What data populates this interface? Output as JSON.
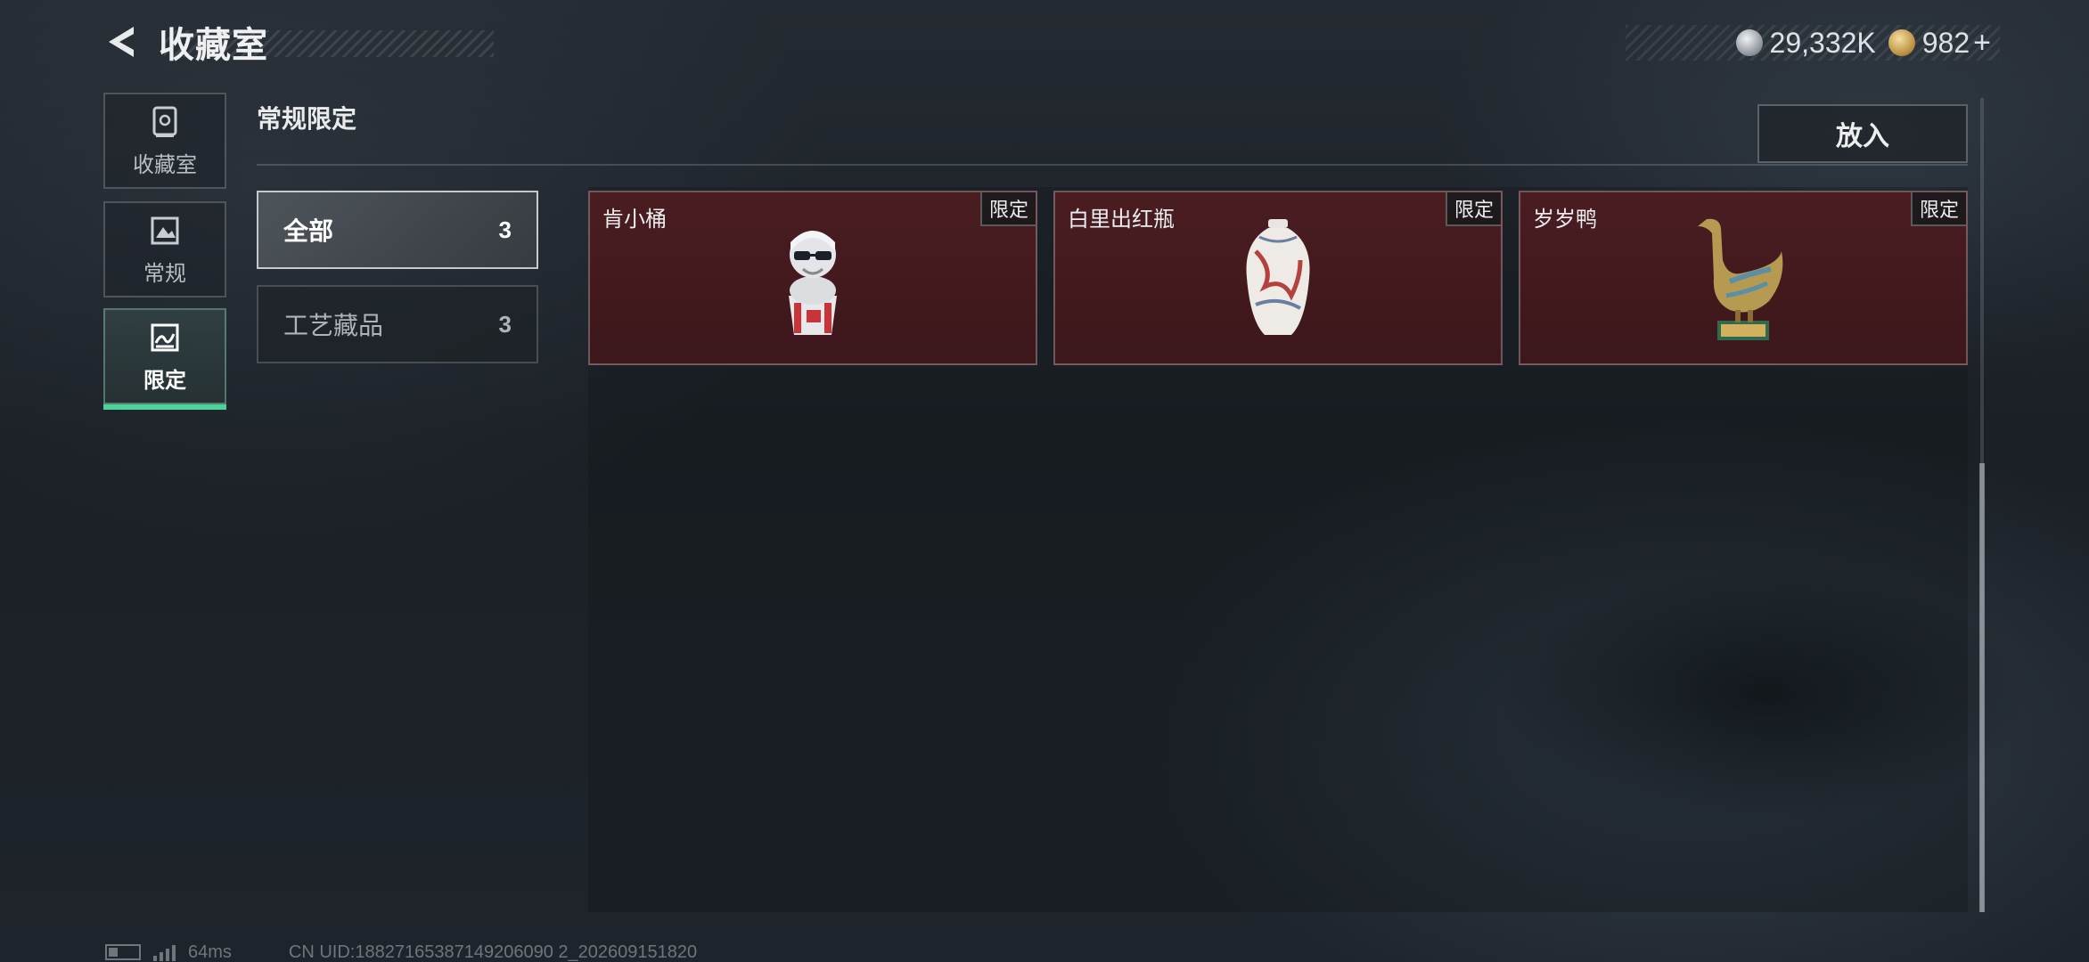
{
  "header": {
    "title": "收藏室"
  },
  "currency": {
    "silver": "29,332K",
    "gold": "982",
    "plus": "+"
  },
  "nav": [
    {
      "label": "收藏室",
      "icon": "safe-icon"
    },
    {
      "label": "常规",
      "icon": "painting-icon"
    },
    {
      "label": "限定",
      "icon": "limited-icon",
      "active": true
    }
  ],
  "section": {
    "title": "常规限定",
    "put_in_label": "放入"
  },
  "categories": [
    {
      "label": "全部",
      "count": "3",
      "active": true
    },
    {
      "label": "工艺藏品",
      "count": "3"
    }
  ],
  "items": [
    {
      "name": "肯小桶",
      "badge": "限定",
      "art": "kfc-figure-icon"
    },
    {
      "name": "白里出红瓶",
      "badge": "限定",
      "art": "vase-icon"
    },
    {
      "name": "岁岁鸭",
      "badge": "限定",
      "art": "duck-statue-icon"
    }
  ],
  "footer": {
    "ping": "64ms",
    "uid": "CN UID:18827165387149206090 2_202609151820"
  },
  "colors": {
    "accent": "#4dd29a",
    "card_bg": "#4a1d21"
  }
}
